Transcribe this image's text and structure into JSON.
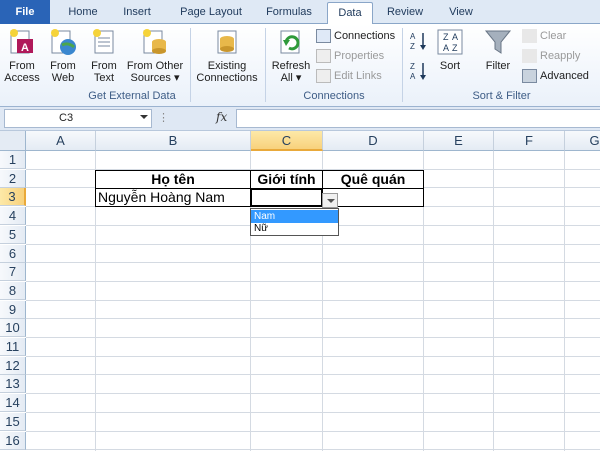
{
  "tabs": [
    "File",
    "Home",
    "Insert",
    "Page Layout",
    "Formulas",
    "Data",
    "Review",
    "View"
  ],
  "active_tab": "Data",
  "ribbon": {
    "get_external": {
      "from_access": "From\nAccess",
      "from_web": "From\nWeb",
      "from_text": "From\nText",
      "from_other": "From Other\nSources ▾",
      "existing": "Existing\nConnections",
      "label": "Get External Data"
    },
    "connections": {
      "refresh": "Refresh\nAll ▾",
      "connections": "Connections",
      "properties": "Properties",
      "edit_links": "Edit Links",
      "label": "Connections"
    },
    "sort_filter": {
      "sort": "Sort",
      "filter": "Filter",
      "clear": "Clear",
      "reapply": "Reapply",
      "advanced": "Advanced",
      "label": "Sort & Filter"
    }
  },
  "formula_bar": {
    "name_box": "C3",
    "fx": "fx",
    "value": ""
  },
  "grid": {
    "columns": [
      "A",
      "B",
      "C",
      "D",
      "E",
      "F",
      "G"
    ],
    "selected_column": "C",
    "rows": [
      "1",
      "2",
      "3",
      "4",
      "5",
      "6",
      "7",
      "8",
      "9",
      "10",
      "11",
      "12",
      "13",
      "14",
      "15",
      "16"
    ],
    "selected_row": "3",
    "cells": {
      "B2": "Họ tên",
      "C2": "Giới tính",
      "D2": "Quê quán",
      "B3": "Nguyễn Hoàng Nam"
    }
  },
  "dropdown": {
    "options": [
      "Nam",
      "Nữ"
    ],
    "highlighted": "Nam"
  }
}
